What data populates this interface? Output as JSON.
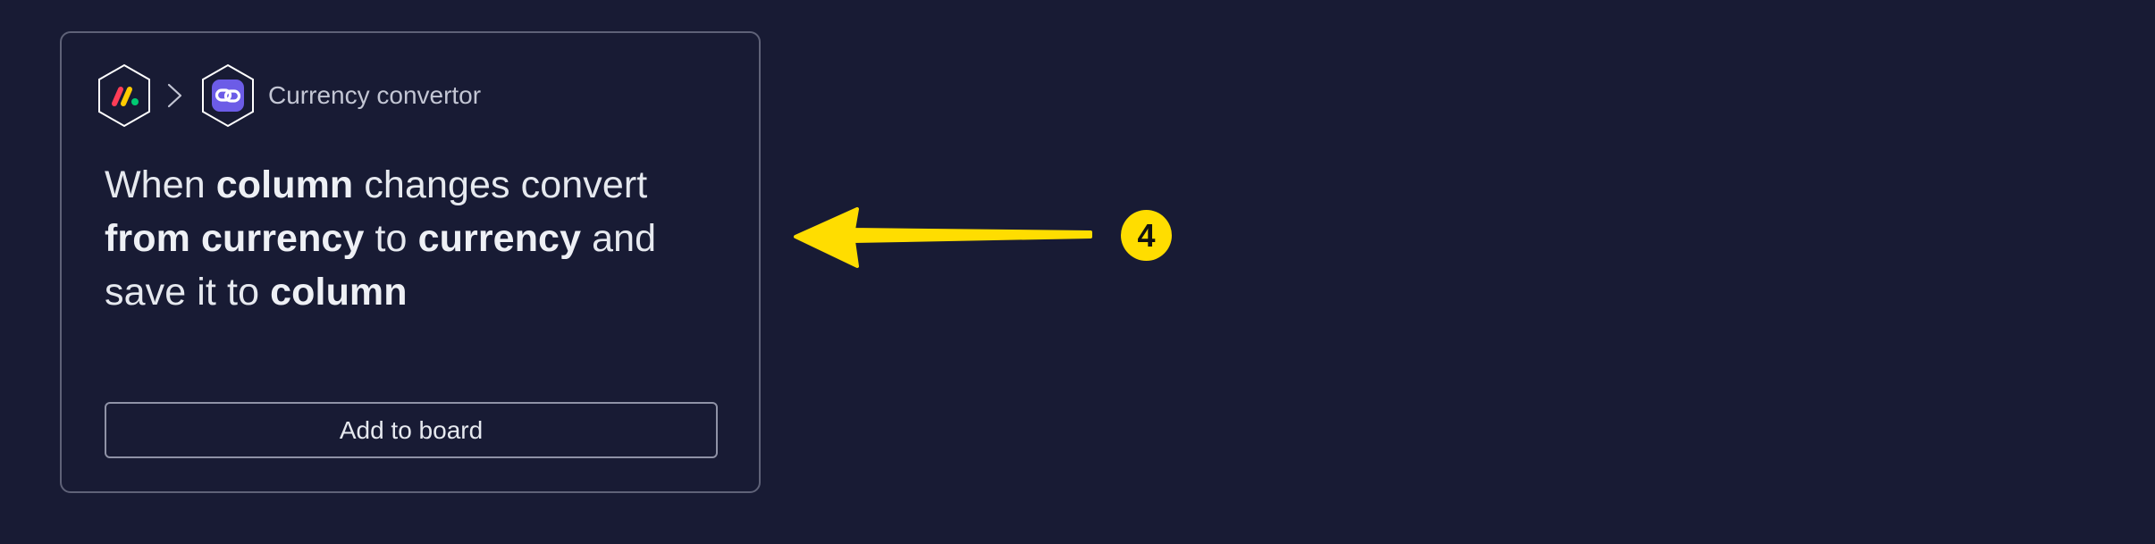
{
  "card": {
    "source_app_icon": "monday-logo-icon",
    "target_app_icon": "link-chain-icon",
    "separator_icon": "chevron-right-icon",
    "app_name": "Currency convertor",
    "recipe": {
      "t1": "When ",
      "b1": "column",
      "t2": " changes convert ",
      "b2": "from currency",
      "t3": " to ",
      "b3": "currency",
      "t4": " and save it to ",
      "b4": "column"
    },
    "add_button_label": "Add to board"
  },
  "annotation": {
    "step_number": "4",
    "arrow_icon": "arrow-left-icon",
    "color": "#ffdd00"
  },
  "colors": {
    "background": "#181b34",
    "card_border": "#5f6278",
    "target_app_accent": "#6c5ce7",
    "monday_red": "#ff3d57",
    "monday_yellow": "#ffcb00",
    "monday_green": "#00ca72"
  }
}
